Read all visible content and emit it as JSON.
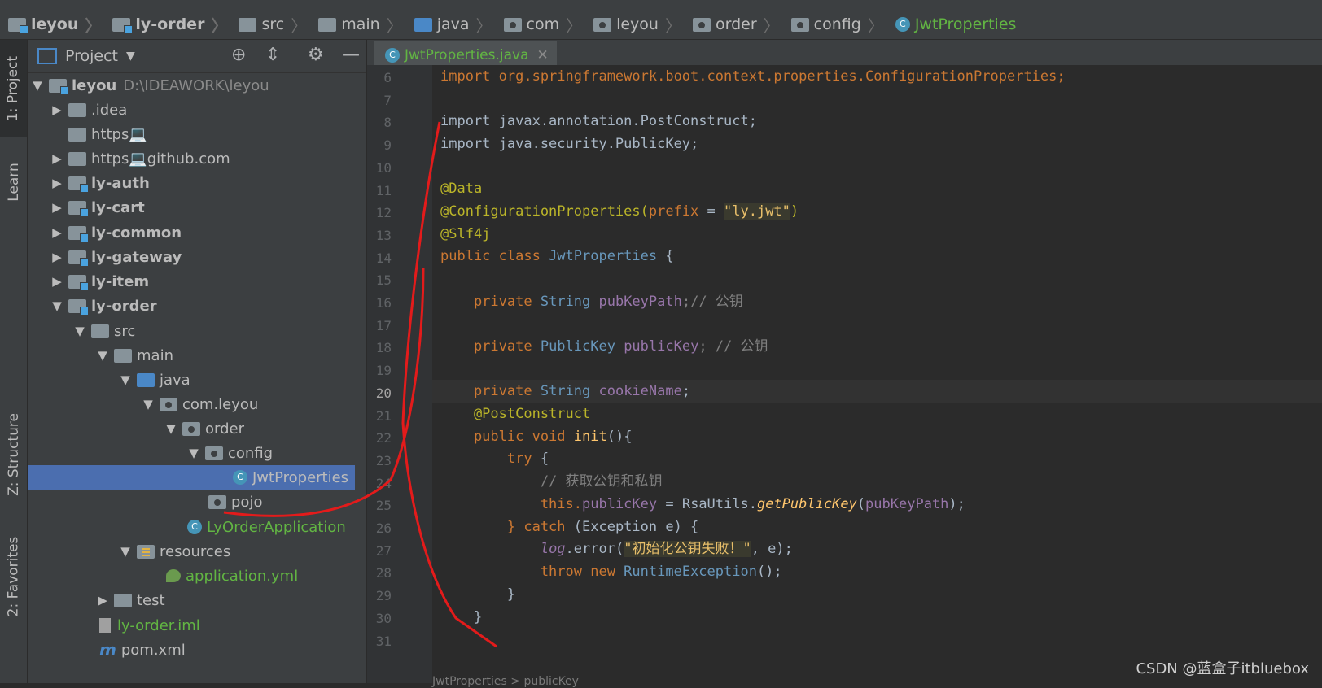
{
  "breadcrumb": [
    "leyou",
    "ly-order",
    "src",
    "main",
    "java",
    "com",
    "leyou",
    "order",
    "config",
    "JwtProperties"
  ],
  "sidebar_tabs": {
    "project": "1: Project",
    "learn": "Learn",
    "structure": "Z: Structure",
    "favorites": "2: Favorites"
  },
  "project_panel": {
    "title": "Project",
    "tree": [
      {
        "label": "leyou",
        "extra": "D:\\IDEAWORK\\leyou"
      },
      {
        "label": ".idea"
      },
      {
        "label": "https💻"
      },
      {
        "label": "https💻github.com"
      },
      {
        "label": "ly-auth"
      },
      {
        "label": "ly-cart"
      },
      {
        "label": "ly-common"
      },
      {
        "label": "ly-gateway"
      },
      {
        "label": "ly-item"
      },
      {
        "label": "ly-order"
      },
      {
        "label": "src"
      },
      {
        "label": "main"
      },
      {
        "label": "java"
      },
      {
        "label": "com.leyou"
      },
      {
        "label": "order"
      },
      {
        "label": "config"
      },
      {
        "label": "JwtProperties"
      },
      {
        "label": "pojo"
      },
      {
        "label": "LyOrderApplication"
      },
      {
        "label": "resources"
      },
      {
        "label": "application.yml"
      },
      {
        "label": "test"
      },
      {
        "label": "ly-order.iml"
      },
      {
        "label": "pom.xml"
      }
    ]
  },
  "editor": {
    "tab_label": "JwtProperties.java",
    "line_numbers": [
      "6",
      "7",
      "8",
      "9",
      "10",
      "11",
      "12",
      "13",
      "14",
      "15",
      "16",
      "17",
      "18",
      "19",
      "20",
      "21",
      "22",
      "23",
      "24",
      "25",
      "26",
      "27",
      "28",
      "29",
      "30",
      "31"
    ]
  },
  "code": {
    "l6": "import org.springframework.boot.context.properties.ConfigurationProperties;",
    "l8": "import javax.annotation.PostConstruct;",
    "l9": "import java.security.PublicKey;",
    "l11": "@Data",
    "l12a": "@ConfigurationProperties(",
    "l12b": "prefix",
    "l12c": " = ",
    "l12d": "\"ly.jwt\"",
    "l12e": ")",
    "l13": "@Slf4j",
    "l14a": "public class ",
    "l14b": "JwtProperties",
    "l14c": " {",
    "l16a": "    private ",
    "l16b": "String ",
    "l16c": "pubKeyPath",
    "l16d": ";// 公钥",
    "l18a": "    private ",
    "l18b": "PublicKey ",
    "l18c": "publicKey",
    "l18d": "; // 公钥",
    "l20a": "    private ",
    "l20b": "String ",
    "l20c": "cookieName",
    "l20d": ";",
    "l21": "    @PostConstruct",
    "l22a": "    public void ",
    "l22b": "init",
    "l22c": "(){",
    "l23a": "        try ",
    "l23b": "{",
    "l24": "            // 获取公钥和私钥",
    "l25a": "            this.",
    "l25b": "publicKey",
    "l25c": " = ",
    "l25d": "RsaUtils.",
    "l25e": "getPublicKey",
    "l25f": "(",
    "l25g": "pubKeyPath",
    "l25h": ");",
    "l26a": "        } catch ",
    "l26b": "(Exception e) {",
    "l27a": "            ",
    "l27b": "log",
    "l27c": ".error(",
    "l27d": "\"初始化公钥失败！\"",
    "l27e": ", e);",
    "l28a": "            throw new ",
    "l28b": "RuntimeException",
    "l28c": "();",
    "l29": "        }",
    "l30": "    }"
  },
  "watermark": "CSDN @蓝盒子itbluebox",
  "status_fragment": "JwtProperties > publicKey"
}
